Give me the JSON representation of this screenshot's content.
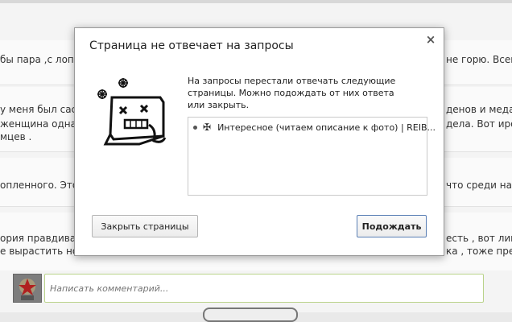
{
  "background": {
    "lines": [
      {
        "left": "бы пара ,с лоп",
        "right": "не горю. Всем"
      },
      {
        "left": "у меня был сасе",
        "right": "денов и медал"
      },
      {
        "left": "женщина однак",
        "right": "дела. Вот ирон"
      },
      {
        "left": "мцев .",
        "right": ""
      },
      {
        "left": "опленного. Этот",
        "right": "что среди нац"
      },
      {
        "left": "ория правдива -",
        "right": "есть , вот лиш"
      },
      {
        "left": "е вырастить но",
        "right": "ка , тоже прет"
      }
    ],
    "comment_placeholder": "Написать комментарий..."
  },
  "dialog": {
    "title": "Страница не отвечает на запросы",
    "close_glyph": "×",
    "message": "На запросы перестали отвечать следующие страницы. Можно подождать от них ответа или закрыть.",
    "pages": [
      {
        "favicon": "✠",
        "title": "Интересное (читаем описание к фото) | REIB..."
      }
    ],
    "buttons": {
      "close_pages": "Закрыть страницы",
      "wait": "Подождать"
    }
  },
  "colors": {
    "input_border": "#b9d38a",
    "primary_button_border": "#5a7fb5"
  }
}
